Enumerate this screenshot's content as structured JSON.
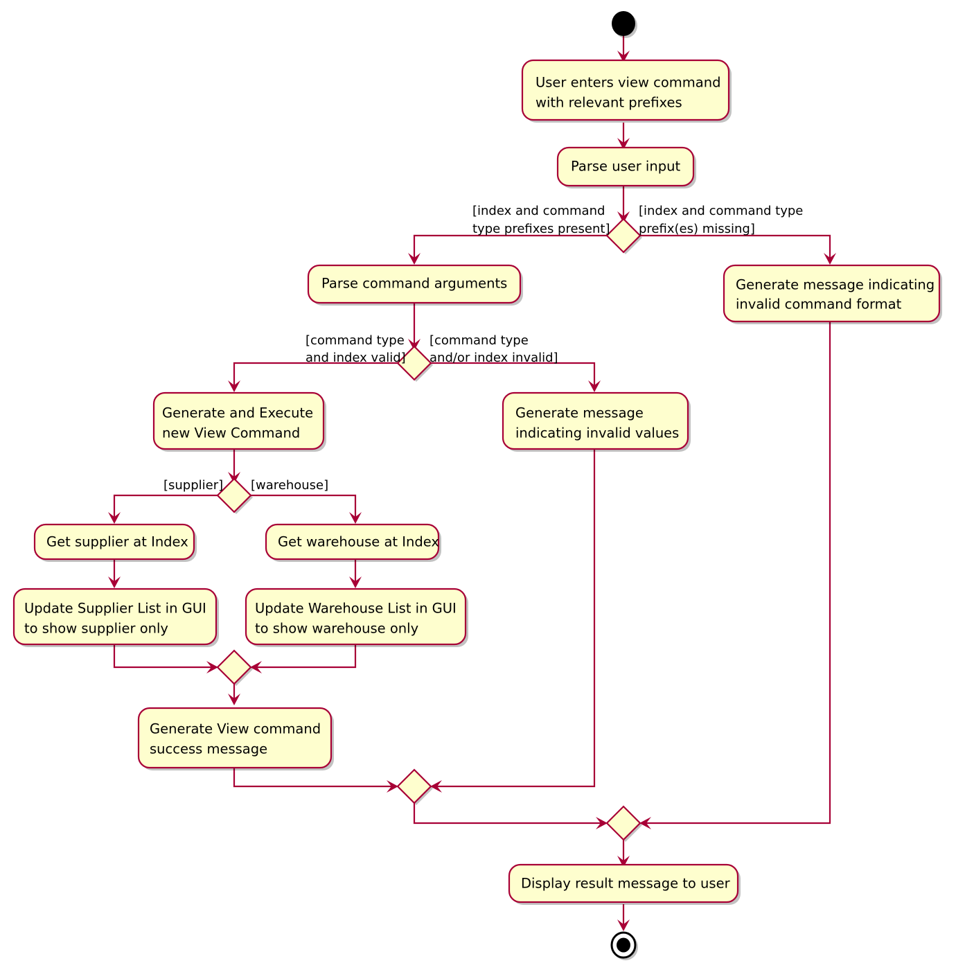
{
  "diagram": {
    "type": "uml-activity-diagram",
    "title": "View command activity diagram",
    "colors": {
      "node_fill": "#FEFECE",
      "node_border": "#A80036",
      "flow_line": "#A80036",
      "start_node": "#000000",
      "text": "#000000",
      "background": "#FFFFFF"
    },
    "start_node": "start",
    "end_node": "end",
    "activities": {
      "a1_line1": "User enters view command",
      "a1_line2": "with relevant prefixes",
      "a2": "Parse user input",
      "a3": "Parse command arguments",
      "a4_line1": "Generate message indicating",
      "a4_line2": "invalid command format",
      "a5_line1": "Generate and Execute",
      "a5_line2": "new View Command",
      "a6_line1": "Generate message",
      "a6_line2": "indicating invalid values",
      "a7": "Get supplier at Index",
      "a8": "Get warehouse at Index",
      "a9_line1": "Update Supplier List in GUI",
      "a9_line2": "to show supplier only",
      "a10_line1": "Update Warehouse List in GUI",
      "a10_line2": "to show warehouse only",
      "a11_line1": "Generate View command",
      "a11_line2": "success message",
      "a12": "Display result message to user"
    },
    "guards": {
      "g1_line1": "[index and command",
      "g1_line2": "type prefixes present]",
      "g2_line1": "[index and command type",
      "g2_line2": "prefix(es) missing]",
      "g3_line1": "[command type",
      "g3_line2": "and index valid]",
      "g4_line1": "[command type",
      "g4_line2": "and/or index invalid]",
      "g5": "[supplier]",
      "g6": "[warehouse]"
    },
    "decisions": {
      "d1": "prefix-check-decision",
      "d2": "validity-check-decision",
      "d3": "command-type-decision",
      "m1": "supplier-warehouse-merge",
      "m2": "success-invalid-merge",
      "m3": "final-merge"
    }
  }
}
